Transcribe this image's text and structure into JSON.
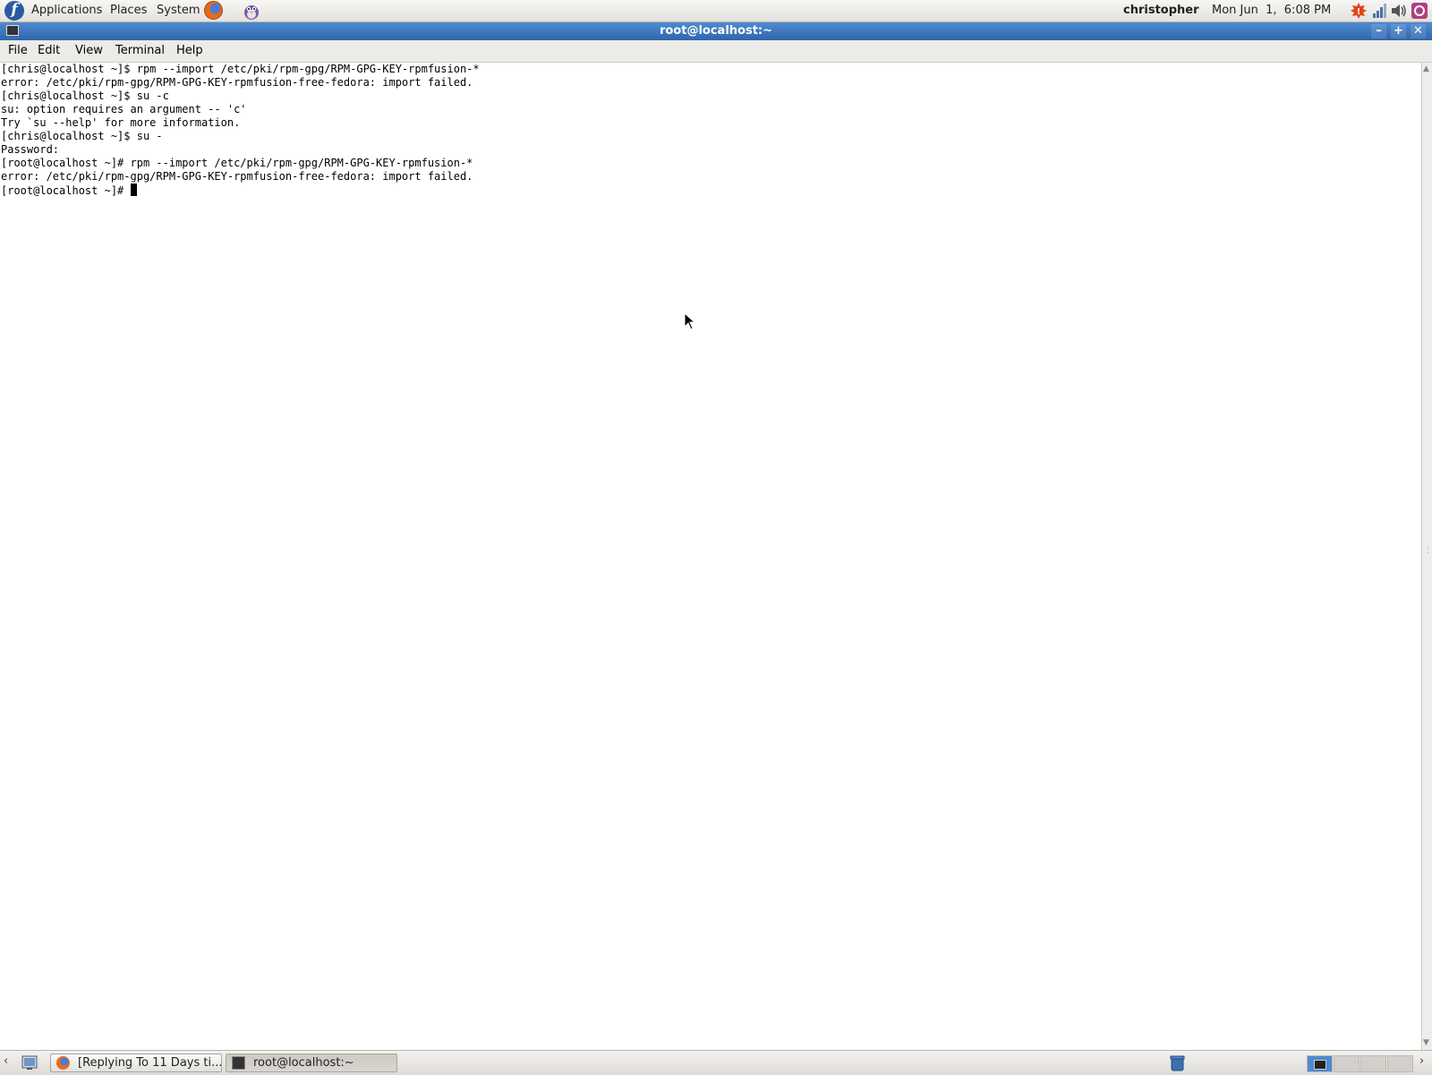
{
  "top_panel": {
    "menus": [
      "Applications",
      "Places",
      "System"
    ],
    "user": "christopher",
    "clock": "Mon Jun  1,  6:08 PM"
  },
  "window": {
    "title": "root@localhost:~",
    "menu": [
      "File",
      "Edit",
      "View",
      "Terminal",
      "Help"
    ]
  },
  "terminal": {
    "lines": [
      "[chris@localhost ~]$ rpm --import /etc/pki/rpm-gpg/RPM-GPG-KEY-rpmfusion-*",
      "error: /etc/pki/rpm-gpg/RPM-GPG-KEY-rpmfusion-free-fedora: import failed.",
      "[chris@localhost ~]$ su -c",
      "su: option requires an argument -- 'c'",
      "Try `su --help' for more information.",
      "[chris@localhost ~]$ su -",
      "Password:",
      "[root@localhost ~]# rpm --import /etc/pki/rpm-gpg/RPM-GPG-KEY-rpmfusion-*",
      "error: /etc/pki/rpm-gpg/RPM-GPG-KEY-rpmfusion-free-fedora: import failed.",
      "[root@localhost ~]# "
    ]
  },
  "taskbar": {
    "tasks": [
      {
        "label": "[Replying To 11 Days ti...",
        "icon": "firefox-icon"
      },
      {
        "label": "root@localhost:~",
        "icon": "terminal-icon"
      }
    ]
  },
  "colors": {
    "titlebar": "#3a74bd",
    "panel": "#ecebe8",
    "terminal_bg": "#ffffff",
    "terminal_fg": "#000000"
  }
}
